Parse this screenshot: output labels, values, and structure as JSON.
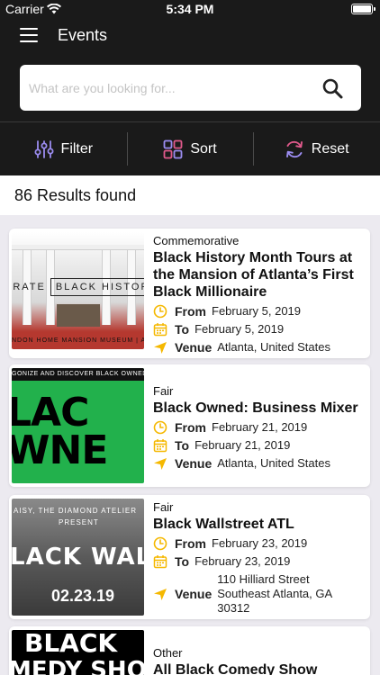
{
  "status_bar": {
    "carrier": "Carrier",
    "time": "5:34 PM"
  },
  "header": {
    "title": "Events"
  },
  "search": {
    "placeholder": "What are you looking for..."
  },
  "actions": {
    "filter": "Filter",
    "sort": "Sort",
    "reset": "Reset"
  },
  "results": {
    "count_text": "86 Results found"
  },
  "colors": {
    "accent_yellow": "#f5b800",
    "header_bg": "#1a1a1a",
    "list_bg": "#eceaf0"
  },
  "events": [
    {
      "category": "Commemorative",
      "title": "Black History Month Tours at the Mansion of Atlanta’s First Black Millionaire",
      "from_label": "From",
      "from": "February 5, 2019",
      "to_label": "To",
      "to": "February 5, 2019",
      "venue_label": "Venue",
      "venue": "Atlanta, United States",
      "thumb": {
        "banner_left": "BRATE",
        "banner_box": "BLACK HISTOR",
        "footer": "NDON HOME MANSION MUSEUM | A"
      }
    },
    {
      "category": "Fair",
      "title": "Black Owned: Business Mixer",
      "from_label": "From",
      "from": "February 21, 2019",
      "to_label": "To",
      "to": "February 21, 2019",
      "venue_label": "Venue",
      "venue": "Atlanta, United States",
      "thumb": {
        "top": "GONIZE AND DISCOVER BLACK OWNED B",
        "line1": "LAC",
        "line2": "WNE"
      }
    },
    {
      "category": "Fair",
      "title": "Black Wallstreet ATL",
      "from_label": "From",
      "from": "February 23, 2019",
      "to_label": "To",
      "to": "February 23, 2019",
      "venue_label": "Venue",
      "venue": "110 Hilliard Street\nSoutheast Atlanta, GA\n30312",
      "thumb": {
        "line1": "AISY, THE DIAMOND ATELIER",
        "line2": "PRESENT",
        "big": "LACK WALLS",
        "date": "02.23.19"
      }
    },
    {
      "category": "Other",
      "title": "All Black Comedy Show",
      "thumb": {
        "line1": "BLACK",
        "line2": "MEDY SHO"
      }
    }
  ]
}
